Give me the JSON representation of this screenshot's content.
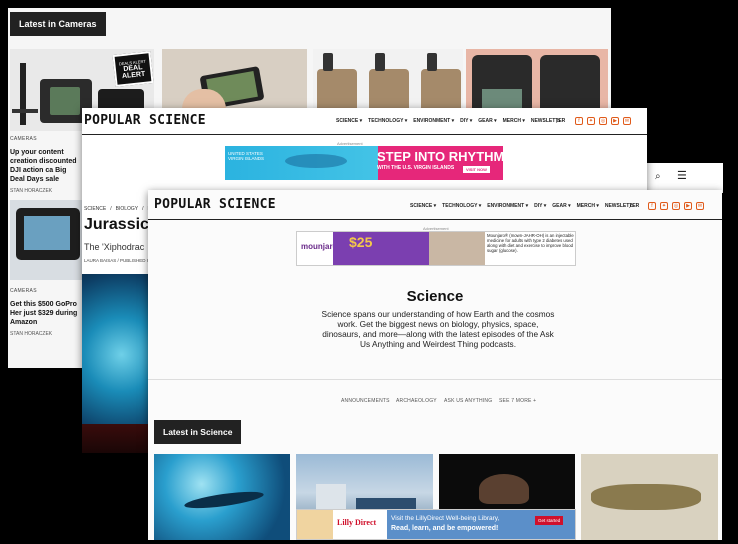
{
  "cameras_window": {
    "section_label": "Latest in Cameras",
    "badge": "DEAL ALERT",
    "badge_sub": "DEALS ALERT",
    "articles": [
      {
        "category": "CAMERAS",
        "headline": "Up your content creation discounted DJI action ca Big Deal Days sale",
        "author": "STAN HORACZEK"
      },
      {
        "category": "CAMERAS",
        "headline": "Get this $500 GoPro Her just $329 during Amazon",
        "author": "STAN HORACZEK"
      }
    ]
  },
  "article_window": {
    "logo": "POPULAR SCIENCE",
    "nav": [
      "SCIENCE ▾",
      "TECHNOLOGY ▾",
      "ENVIRONMENT ▾",
      "DIY ▾",
      "GEAR ▾",
      "MERCH ▾",
      "NEWSLETTER"
    ],
    "ad_label": "Advertisement",
    "ad_headline": "STEP INTO RHYTHM",
    "ad_sub": "WITH THE U.S. VIRGIN ISLANDS",
    "ad_cta": "VISIT NOW",
    "ad_logo": "UNITED STATES VIRGIN ISLANDS",
    "breadcrumb": [
      "SCIENCE",
      "BIOLOGY",
      "EV"
    ],
    "headline": "Jurassic 's",
    "subhead": "The 'Xiphodrac",
    "byline": "LAURA BAISAS / PUBLISHED O"
  },
  "science_window": {
    "logo": "POPULAR SCIENCE",
    "nav": [
      "SCIENCE ▾",
      "TECHNOLOGY ▾",
      "ENVIRONMENT ▾",
      "DIY ▾",
      "GEAR ▾",
      "MERCH ▾",
      "NEWSLETTER"
    ],
    "ad_label": "Advertisement",
    "ad_brand": "mounjaro",
    "ad_price": "$25",
    "ad_text": "Mounjaro® (mown-JAHR-OH) is an injectable medicine for adults with type 2 diabetes used along with diet and exercise to improve blood sugar (glucose).",
    "title": "Science",
    "description": "Science spans our understanding of how Earth and the cosmos work. Get the biggest news on biology, physics, space, dinosaurs, and more—along with the latest episodes of the Ask Us Anything and Weirdest Thing podcasts.",
    "topics": [
      "ANNOUNCEMENTS",
      "ARCHAEOLOGY",
      "ASK US ANYTHING",
      "SEE 7 MORE +"
    ],
    "latest_label": "Latest in Science",
    "bottom_ad": {
      "brand": "Lilly Direct",
      "text1": "Visit the LillyDirect Well-being Library,",
      "text2": "Read, learn, and be empowered!",
      "cta": "Get started"
    }
  },
  "colors": {
    "accent": "#e05a1a",
    "dark": "#222222",
    "ad_pink": "#e6277a",
    "ad_blue": "#1e9bd0"
  }
}
